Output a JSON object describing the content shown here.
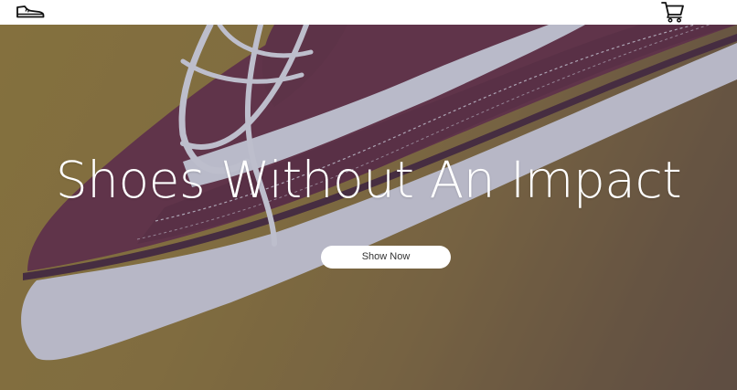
{
  "nav": {
    "logo_icon": "sneaker-icon",
    "cart_icon": "shopping-cart-icon"
  },
  "hero": {
    "headline": "Shoes Without An Impact",
    "cta_label": "Show Now",
    "background_image": "maroon canvas sneaker with white laces on mustard background"
  },
  "colors": {
    "nav_background": "#ffffff",
    "hero_background": "#9a7c2e",
    "shoe_canvas": "#6e2f3c",
    "shoe_sole": "#e8e6ea",
    "overlay_tint": "#3c466e",
    "headline_text": "#ffffff",
    "button_background": "#ffffff",
    "button_text": "#333333"
  }
}
